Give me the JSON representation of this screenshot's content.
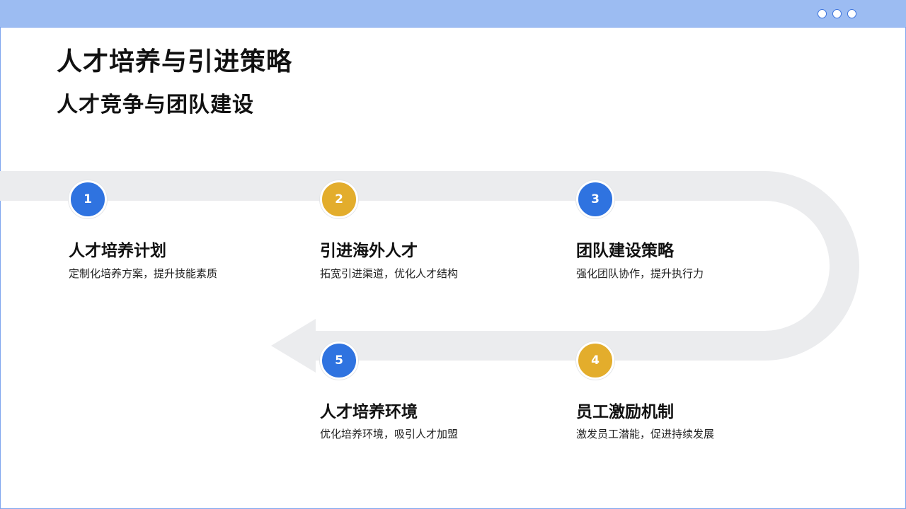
{
  "header": {
    "title": "人才培养与引进策略",
    "subtitle": "人才竞争与团队建设"
  },
  "colors": {
    "topbar": "#9cbcf2",
    "border": "#7fa6ee",
    "track": "#ebecee",
    "blue": "#2f73e0",
    "gold": "#e3ad2c"
  },
  "steps": [
    {
      "num": "1",
      "title": "人才培养计划",
      "desc": "定制化培养方案，提升技能素质"
    },
    {
      "num": "2",
      "title": "引进海外人才",
      "desc": "拓宽引进渠道，优化人才结构"
    },
    {
      "num": "3",
      "title": "团队建设策略",
      "desc": "强化团队协作，提升执行力"
    },
    {
      "num": "4",
      "title": "员工激励机制",
      "desc": "激发员工潜能，促进持续发展"
    },
    {
      "num": "5",
      "title": "人才培养环境",
      "desc": "优化培养环境，吸引人才加盟"
    }
  ]
}
